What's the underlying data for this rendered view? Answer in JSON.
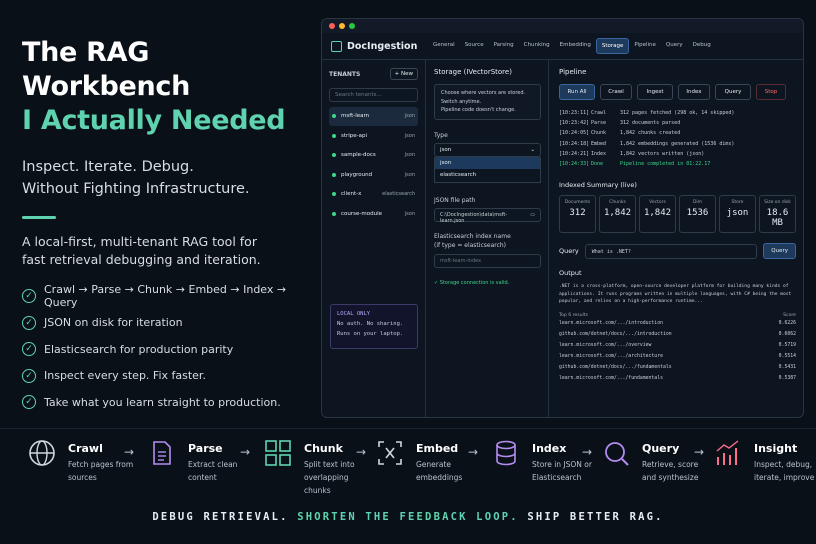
{
  "hero": {
    "line1": "The RAG Workbench",
    "line2": "I Actually Needed",
    "sub1": "Inspect. Iterate. Debug.",
    "sub2": "Without Fighting Infrastructure.",
    "desc1": "A local-first, multi-tenant RAG tool for",
    "desc2": "fast retrieval debugging and iteration.",
    "features": [
      "Crawl → Parse → Chunk → Embed → Index → Query",
      "JSON on disk for iteration",
      "Elasticsearch for production parity",
      "Inspect every step. Fix faster.",
      "Take what you learn straight to production."
    ]
  },
  "app": {
    "name": "DocIngestion",
    "tabs": [
      "General",
      "Source",
      "Parsing",
      "Chunking",
      "Embedding",
      "Storage",
      "Pipeline",
      "Query",
      "Debug"
    ],
    "active_tab": "Storage",
    "tenants": {
      "title": "TENANTS",
      "new": "+ New",
      "search": "Search tenants...",
      "items": [
        {
          "name": "msft-learn",
          "type": "json"
        },
        {
          "name": "stripe-api",
          "type": "json"
        },
        {
          "name": "sample-docs",
          "type": "json"
        },
        {
          "name": "playground",
          "type": "json"
        },
        {
          "name": "client-x",
          "type": "elasticsearch"
        },
        {
          "name": "course-module",
          "type": "json"
        }
      ],
      "local_title": "LOCAL ONLY",
      "local_1": "No auth. No sharing.",
      "local_2": "Runs on your laptop."
    },
    "storage": {
      "title": "Storage (IVectorStore)",
      "note1": "Choose where vectors are stored.",
      "note2": "Switch anytime.",
      "note3": "Pipeline code doesn't change.",
      "type_label": "Type",
      "type_value": "json",
      "options": [
        "json",
        "elasticsearch"
      ],
      "path_label": "JSON file path",
      "path_value": "C:\\DocIngestion\\data\\msft-learn.json",
      "es_label1": "Elasticsearch index name",
      "es_label2": "(if type = elasticsearch)",
      "es_placeholder": "msft-learn-index",
      "ok": "✓ Storage connection is valid."
    },
    "pipeline": {
      "title": "Pipeline",
      "buttons": [
        "Run All",
        "Crawl",
        "Ingest",
        "Index",
        "Query",
        "Stop"
      ],
      "log": [
        {
          "t": "[10:23:11]",
          "s": "Crawl",
          "m": "312 pages fetched (298 ok, 14 skipped)"
        },
        {
          "t": "[10:23:42]",
          "s": "Parse",
          "m": "312 documents parsed"
        },
        {
          "t": "[10:24:05]",
          "s": "Chunk",
          "m": "1,842 chunks created"
        },
        {
          "t": "[10:24:18]",
          "s": "Embed",
          "m": "1,842 embeddings generated (1536 dims)"
        },
        {
          "t": "[10:24:21]",
          "s": "Index",
          "m": "1,842 vectors written (json)"
        },
        {
          "t": "[10:24:33]",
          "s": "Done",
          "m": "Pipeline completed in 01:22.17"
        }
      ],
      "summary_title": "Indexed Summary (live)",
      "summary": [
        {
          "k": "Documents",
          "v": "312"
        },
        {
          "k": "Chunks",
          "v": "1,842"
        },
        {
          "k": "Vectors",
          "v": "1,842"
        },
        {
          "k": "Dim",
          "v": "1536"
        },
        {
          "k": "Store",
          "v": "json"
        },
        {
          "k": "Size on disk",
          "v": "18.6 MB"
        }
      ],
      "query_label": "Query",
      "query_value": "What is .NET?",
      "query_btn": "Query",
      "output_title": "Output",
      "output": ".NET is a cross-platform, open-source developer platform for building many kinds of applications. It runs programs written in multiple languages, with C# being the most popular, and relies on a high-performance runtime...",
      "results_title": "Top 6 results",
      "score_title": "Score",
      "results": [
        {
          "u": "learn.microsoft.com/.../introduction",
          "s": "0.6226"
        },
        {
          "u": "github.com/dotnet/docs/.../introduction",
          "s": "0.6062"
        },
        {
          "u": "learn.microsoft.com/.../overview",
          "s": "0.5719"
        },
        {
          "u": "learn.microsoft.com/.../architecture",
          "s": "0.5514"
        },
        {
          "u": "github.com/dotnet/docs/.../fundamentals",
          "s": "0.5431"
        },
        {
          "u": "learn.microsoft.com/.../fundamentals",
          "s": "0.5387"
        }
      ]
    }
  },
  "flow": [
    {
      "t": "Crawl",
      "d": "Fetch pages from sources",
      "icon": "globe-icon"
    },
    {
      "t": "Parse",
      "d": "Extract clean content",
      "icon": "document-icon"
    },
    {
      "t": "Chunk",
      "d": "Split text into overlapping chunks",
      "icon": "grid-icon"
    },
    {
      "t": "Embed",
      "d": "Generate embeddings",
      "icon": "embed-icon"
    },
    {
      "t": "Index",
      "d": "Store in JSON or Elasticsearch",
      "icon": "database-icon"
    },
    {
      "t": "Query",
      "d": "Retrieve, score and synthesize",
      "icon": "search-icon"
    },
    {
      "t": "Insight",
      "d": "Inspect, debug, iterate, improve",
      "icon": "chart-icon"
    }
  ],
  "tagline": {
    "a": "DEBUG RETRIEVAL.",
    "b": "SHORTEN THE FEEDBACK LOOP.",
    "c": "SHIP BETTER RAG."
  },
  "colors": {
    "accent": "#5fd3b0",
    "bg": "#0a1018",
    "stop": "#ff6b6b",
    "ok": "#3dd68c"
  }
}
